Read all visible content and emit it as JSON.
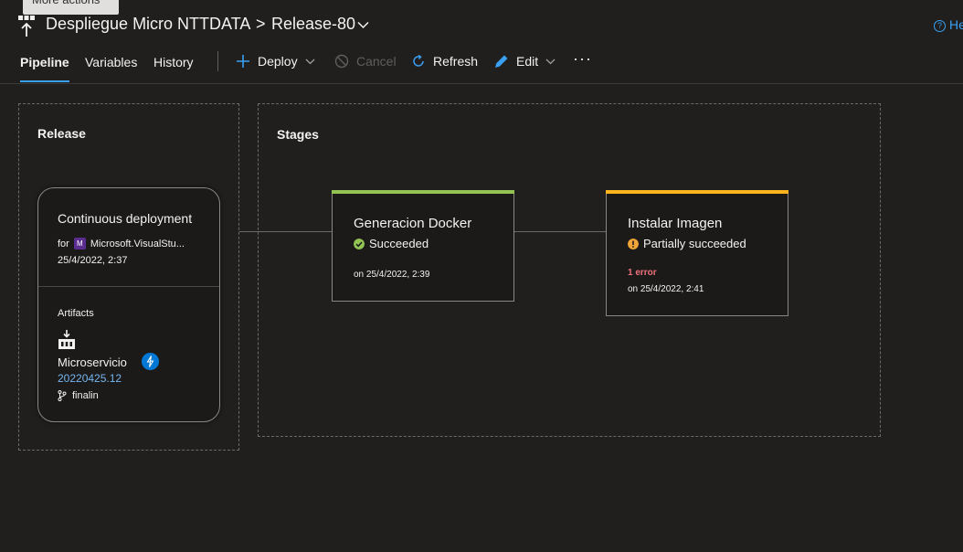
{
  "tooltip": "More actions",
  "header": {
    "pipeline_name": "Despliegue Micro NTTDATA",
    "breadcrumb_separator": ">",
    "release_name": "Release-80",
    "help_label": "He"
  },
  "tabs": [
    {
      "label": "Pipeline",
      "active": true
    },
    {
      "label": "Variables",
      "active": false
    },
    {
      "label": "History",
      "active": false
    }
  ],
  "toolbar": {
    "deploy_label": "Deploy",
    "cancel_label": "Cancel",
    "refresh_label": "Refresh",
    "edit_label": "Edit",
    "more_label": "···"
  },
  "release_panel": {
    "title": "Release",
    "trigger": {
      "title": "Continuous deployment",
      "for_prefix": "for",
      "source_badge": "M",
      "source": "Microsoft.VisualStu...",
      "date": "25/4/2022, 2:37"
    },
    "artifacts_label": "Artifacts",
    "artifact": {
      "name": "Microservicio",
      "version": "20220425.12",
      "branch": "finalin"
    }
  },
  "stages_panel": {
    "title": "Stages",
    "stages": [
      {
        "name": "Generacion Docker",
        "status": "Succeeded",
        "status_color": "#92c353",
        "date": "on 25/4/2022, 2:39"
      },
      {
        "name": "Instalar Imagen",
        "status": "Partially succeeded",
        "status_color": "#fcb41d",
        "error": "1 error",
        "date": "on 25/4/2022, 2:41"
      }
    ]
  },
  "colors": {
    "accent": "#3aa0f3",
    "success": "#92c353",
    "warning": "#fcb41d",
    "error": "#f1707b",
    "background": "#201f1e"
  }
}
